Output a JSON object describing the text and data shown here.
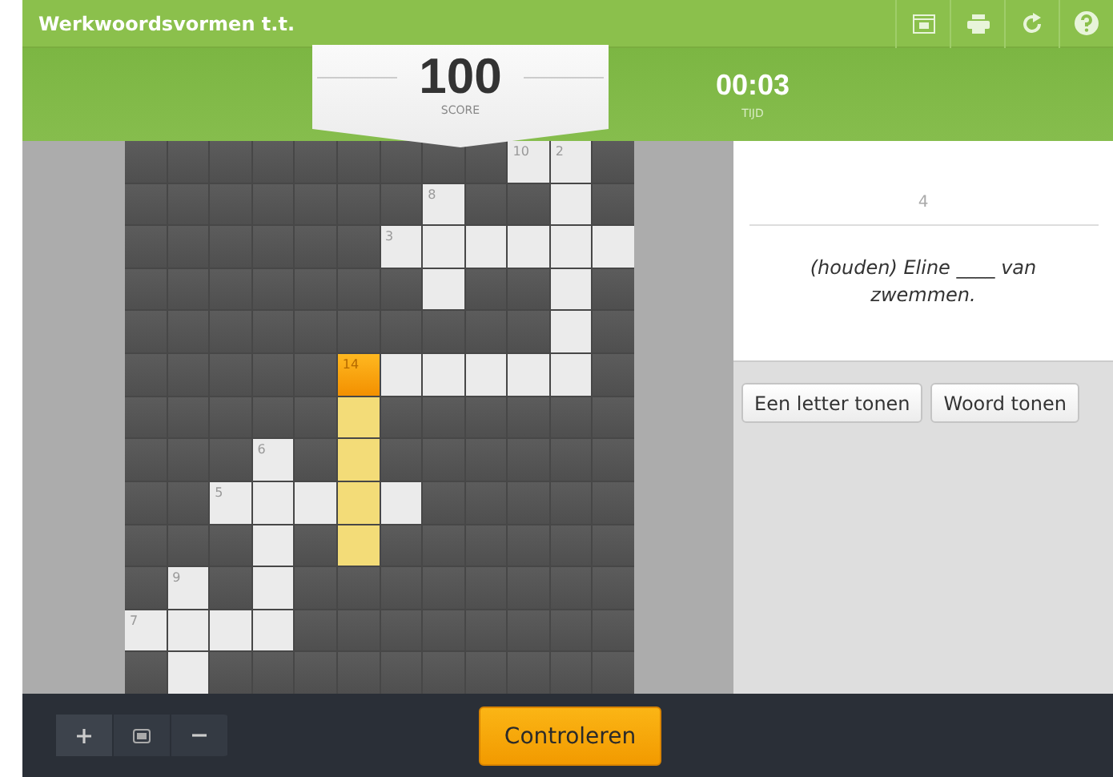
{
  "header": {
    "title": "Werkwoordsvormen t.t."
  },
  "score": {
    "value": "100",
    "label": "SCORE"
  },
  "timer": {
    "value": "00:03",
    "label": "TIJD"
  },
  "grid": {
    "rows": [
      [
        {
          "kind": "block"
        },
        {
          "kind": "block"
        },
        {
          "kind": "block"
        },
        {
          "kind": "block"
        },
        {
          "kind": "block"
        },
        {
          "kind": "block"
        },
        {
          "kind": "block"
        },
        {
          "kind": "block"
        },
        {
          "kind": "block"
        },
        {
          "kind": "open",
          "number": "10"
        },
        {
          "kind": "open",
          "number": "2"
        },
        {
          "kind": "block"
        }
      ],
      [
        {
          "kind": "block"
        },
        {
          "kind": "block"
        },
        {
          "kind": "block"
        },
        {
          "kind": "block"
        },
        {
          "kind": "block"
        },
        {
          "kind": "block"
        },
        {
          "kind": "block"
        },
        {
          "kind": "open",
          "number": "8"
        },
        {
          "kind": "block"
        },
        {
          "kind": "block"
        },
        {
          "kind": "open"
        },
        {
          "kind": "block"
        }
      ],
      [
        {
          "kind": "block"
        },
        {
          "kind": "block"
        },
        {
          "kind": "block"
        },
        {
          "kind": "block"
        },
        {
          "kind": "block"
        },
        {
          "kind": "block"
        },
        {
          "kind": "open",
          "number": "3"
        },
        {
          "kind": "open"
        },
        {
          "kind": "open"
        },
        {
          "kind": "open"
        },
        {
          "kind": "open"
        },
        {
          "kind": "open"
        }
      ],
      [
        {
          "kind": "block"
        },
        {
          "kind": "block"
        },
        {
          "kind": "block"
        },
        {
          "kind": "block"
        },
        {
          "kind": "block"
        },
        {
          "kind": "block"
        },
        {
          "kind": "block"
        },
        {
          "kind": "open"
        },
        {
          "kind": "block"
        },
        {
          "kind": "block"
        },
        {
          "kind": "open"
        },
        {
          "kind": "block"
        }
      ],
      [
        {
          "kind": "block"
        },
        {
          "kind": "block"
        },
        {
          "kind": "block"
        },
        {
          "kind": "block"
        },
        {
          "kind": "block"
        },
        {
          "kind": "block"
        },
        {
          "kind": "block"
        },
        {
          "kind": "block"
        },
        {
          "kind": "block"
        },
        {
          "kind": "block"
        },
        {
          "kind": "open"
        },
        {
          "kind": "block"
        }
      ],
      [
        {
          "kind": "block"
        },
        {
          "kind": "block"
        },
        {
          "kind": "block"
        },
        {
          "kind": "block"
        },
        {
          "kind": "block"
        },
        {
          "kind": "active",
          "number": "14"
        },
        {
          "kind": "open"
        },
        {
          "kind": "open"
        },
        {
          "kind": "open"
        },
        {
          "kind": "open"
        },
        {
          "kind": "open"
        },
        {
          "kind": "block"
        }
      ],
      [
        {
          "kind": "block"
        },
        {
          "kind": "block"
        },
        {
          "kind": "block"
        },
        {
          "kind": "block"
        },
        {
          "kind": "block"
        },
        {
          "kind": "word"
        },
        {
          "kind": "block"
        },
        {
          "kind": "block"
        },
        {
          "kind": "block"
        },
        {
          "kind": "block"
        },
        {
          "kind": "block"
        },
        {
          "kind": "block"
        }
      ],
      [
        {
          "kind": "block"
        },
        {
          "kind": "block"
        },
        {
          "kind": "block"
        },
        {
          "kind": "open",
          "number": "6"
        },
        {
          "kind": "block"
        },
        {
          "kind": "word"
        },
        {
          "kind": "block"
        },
        {
          "kind": "block"
        },
        {
          "kind": "block"
        },
        {
          "kind": "block"
        },
        {
          "kind": "block"
        },
        {
          "kind": "block"
        }
      ],
      [
        {
          "kind": "block"
        },
        {
          "kind": "block"
        },
        {
          "kind": "open",
          "number": "5"
        },
        {
          "kind": "open"
        },
        {
          "kind": "open"
        },
        {
          "kind": "word"
        },
        {
          "kind": "open"
        },
        {
          "kind": "block"
        },
        {
          "kind": "block"
        },
        {
          "kind": "block"
        },
        {
          "kind": "block"
        },
        {
          "kind": "block"
        }
      ],
      [
        {
          "kind": "block"
        },
        {
          "kind": "block"
        },
        {
          "kind": "block"
        },
        {
          "kind": "open"
        },
        {
          "kind": "block"
        },
        {
          "kind": "word"
        },
        {
          "kind": "block"
        },
        {
          "kind": "block"
        },
        {
          "kind": "block"
        },
        {
          "kind": "block"
        },
        {
          "kind": "block"
        },
        {
          "kind": "block"
        }
      ],
      [
        {
          "kind": "block"
        },
        {
          "kind": "open",
          "number": "9"
        },
        {
          "kind": "block"
        },
        {
          "kind": "open"
        },
        {
          "kind": "block"
        },
        {
          "kind": "block"
        },
        {
          "kind": "block"
        },
        {
          "kind": "block"
        },
        {
          "kind": "block"
        },
        {
          "kind": "block"
        },
        {
          "kind": "block"
        },
        {
          "kind": "block"
        }
      ],
      [
        {
          "kind": "open",
          "number": "7"
        },
        {
          "kind": "open"
        },
        {
          "kind": "open"
        },
        {
          "kind": "open"
        },
        {
          "kind": "block"
        },
        {
          "kind": "block"
        },
        {
          "kind": "block"
        },
        {
          "kind": "block"
        },
        {
          "kind": "block"
        },
        {
          "kind": "block"
        },
        {
          "kind": "block"
        },
        {
          "kind": "block"
        }
      ],
      [
        {
          "kind": "block"
        },
        {
          "kind": "open"
        },
        {
          "kind": "block"
        },
        {
          "kind": "block"
        },
        {
          "kind": "block"
        },
        {
          "kind": "block"
        },
        {
          "kind": "block"
        },
        {
          "kind": "block"
        },
        {
          "kind": "block"
        },
        {
          "kind": "block"
        },
        {
          "kind": "block"
        },
        {
          "kind": "block"
        }
      ]
    ]
  },
  "clue": {
    "number": "4",
    "text": "(houden) Eline ____ van zwemmen."
  },
  "hint_buttons": [
    "Een letter tonen",
    "Woord tonen"
  ],
  "check_button": "Controleren"
}
